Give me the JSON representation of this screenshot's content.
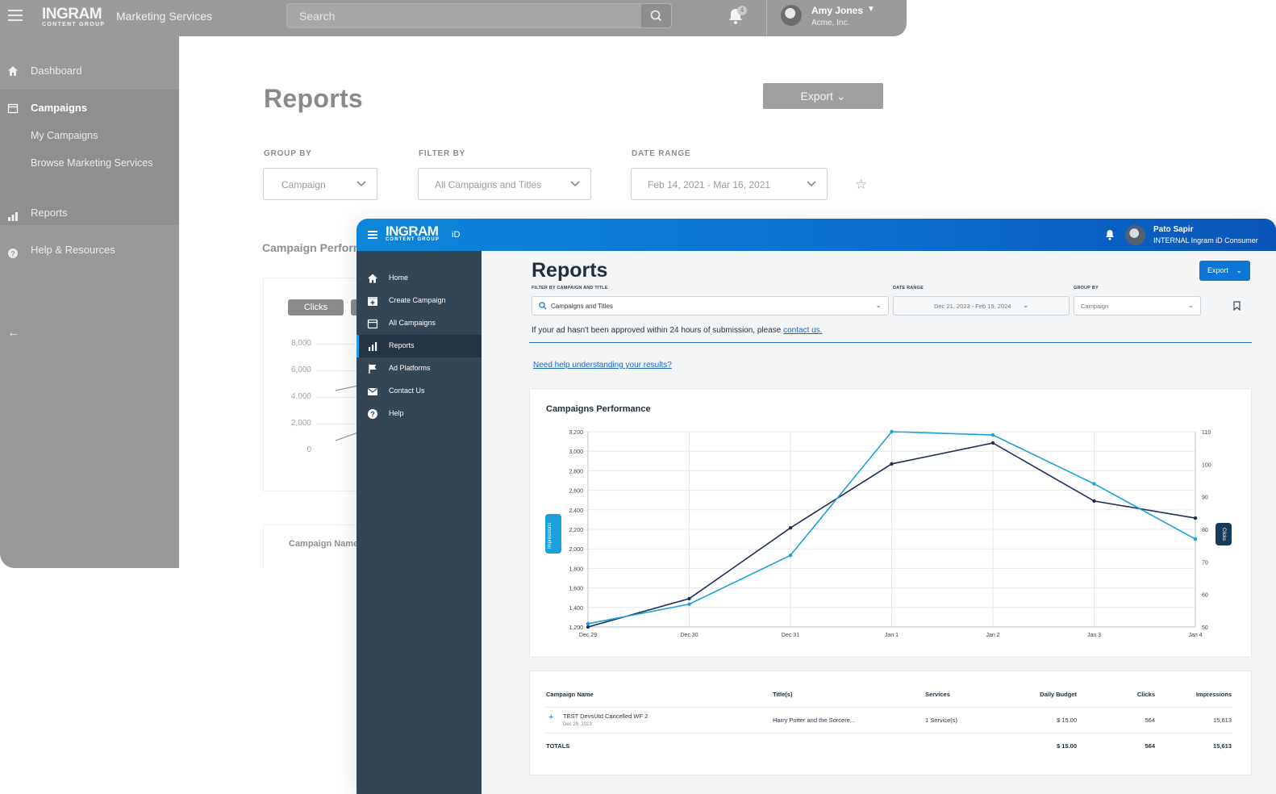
{
  "background_app": {
    "brand": {
      "name": "INGRAM",
      "sub": "CONTENT GROUP"
    },
    "app_name": "Marketing Services",
    "search": {
      "placeholder": "Search"
    },
    "notifications": {
      "count": "4"
    },
    "user": {
      "name": "Amy Jones",
      "org": "Acme, Inc."
    },
    "sidebar": {
      "dashboard": "Dashboard",
      "campaigns": "Campaigns",
      "my_campaigns": "My Campaigns",
      "browse": "Browse Marketing Services",
      "reports": "Reports",
      "help": "Help & Resources"
    },
    "page_title": "Reports",
    "export_label": "Export",
    "filters": {
      "group_by_label": "GROUP BY",
      "group_by_value": "Campaign",
      "filter_by_label": "FILTER BY",
      "filter_by_value": "All Campaigns and Titles",
      "date_range_label": "DATE RANGE",
      "date_range_value": "Feb 14, 2021 - Mar 16, 2021"
    },
    "chart_title_visible": "Campaign Perform",
    "chart_tab": "Clicks",
    "y_ticks": [
      "8,000",
      "6,000",
      "4,000",
      "2,000",
      "0"
    ],
    "table_header": "Campaign Name"
  },
  "app": {
    "brand": {
      "name": "INGRAM",
      "sub": "CONTENT GROUP",
      "suffix": "iD"
    },
    "user": {
      "name": "Pato Sapir",
      "org": "INTERNAL Ingram iD Consumer"
    },
    "sidebar": [
      {
        "label": "Home",
        "icon": "home-icon"
      },
      {
        "label": "Create Campaign",
        "icon": "calendar-plus-icon"
      },
      {
        "label": "All Campaigns",
        "icon": "calendar-icon"
      },
      {
        "label": "Reports",
        "icon": "bar-chart-icon",
        "active": true
      },
      {
        "label": "Ad Platforms",
        "icon": "flag-icon"
      },
      {
        "label": "Contact Us",
        "icon": "envelope-icon"
      },
      {
        "label": "Help",
        "icon": "help-circle-icon"
      }
    ],
    "page_title": "Reports",
    "export_label": "Export",
    "filters": {
      "campaign_label": "FILTER BY CAMPAIGN AND TITLE",
      "campaign_value": "Campaigns and Titles",
      "date_label": "DATE RANGE",
      "date_value": "Dec 21, 2023 - Feb 19, 2024",
      "group_label": "GROUP BY",
      "group_value": "Campaign"
    },
    "notice": {
      "text": "If your ad hasn't been approved within 24 hours of submission, please ",
      "link": "contact us."
    },
    "help_link": "Need help understanding your results?",
    "table": {
      "headers": [
        "Campaign Name",
        "Title(s)",
        "Services",
        "Daily Budget",
        "Clicks",
        "Impressions"
      ],
      "rows": [
        {
          "name": "TEST DevsUtd Cancelled WF 2",
          "date": "Dec 29, 2023",
          "title": "Harry Potter and the Sorcere...",
          "services": "1 Service(s)",
          "budget": "$ 15.00",
          "clicks": "564",
          "impressions": "15,613"
        }
      ],
      "totals": {
        "label": "TOTALS",
        "budget": "$ 15.00",
        "clicks": "564",
        "impressions": "15,613"
      }
    }
  },
  "colors": {
    "primary": "#0b76d6",
    "impressions_line": "#1e2f5c",
    "clicks_line": "#1ba1dc",
    "sidebar": "#344554"
  },
  "chart_data": {
    "type": "line",
    "title": "Campaigns Performance",
    "categories": [
      "Dec 29",
      "Dec 30",
      "Dec 31",
      "Jan 1",
      "Jan 2",
      "Jan 3",
      "Jan 4"
    ],
    "y_left": {
      "label": "Impressions",
      "ticks": [
        "1,200",
        "1,400",
        "1,600",
        "1,800",
        "2,000",
        "2,200",
        "2,400",
        "2,600",
        "2,800",
        "3,000",
        "3,200"
      ],
      "range": [
        1200,
        3200
      ]
    },
    "y_right": {
      "label": "Clicks",
      "ticks": [
        "50",
        "60",
        "70",
        "80",
        "90",
        "100",
        "110"
      ],
      "range": [
        50,
        110
      ]
    },
    "series": [
      {
        "name": "Impressions",
        "axis": "left",
        "color": "#1e2f5c",
        "values": [
          1200,
          1490,
          2215,
          2870,
          3085,
          2490,
          2315
        ]
      },
      {
        "name": "Clicks",
        "axis": "right",
        "color": "#1ba1dc",
        "values": [
          51,
          57,
          72,
          110,
          109,
          94,
          77
        ]
      }
    ]
  }
}
